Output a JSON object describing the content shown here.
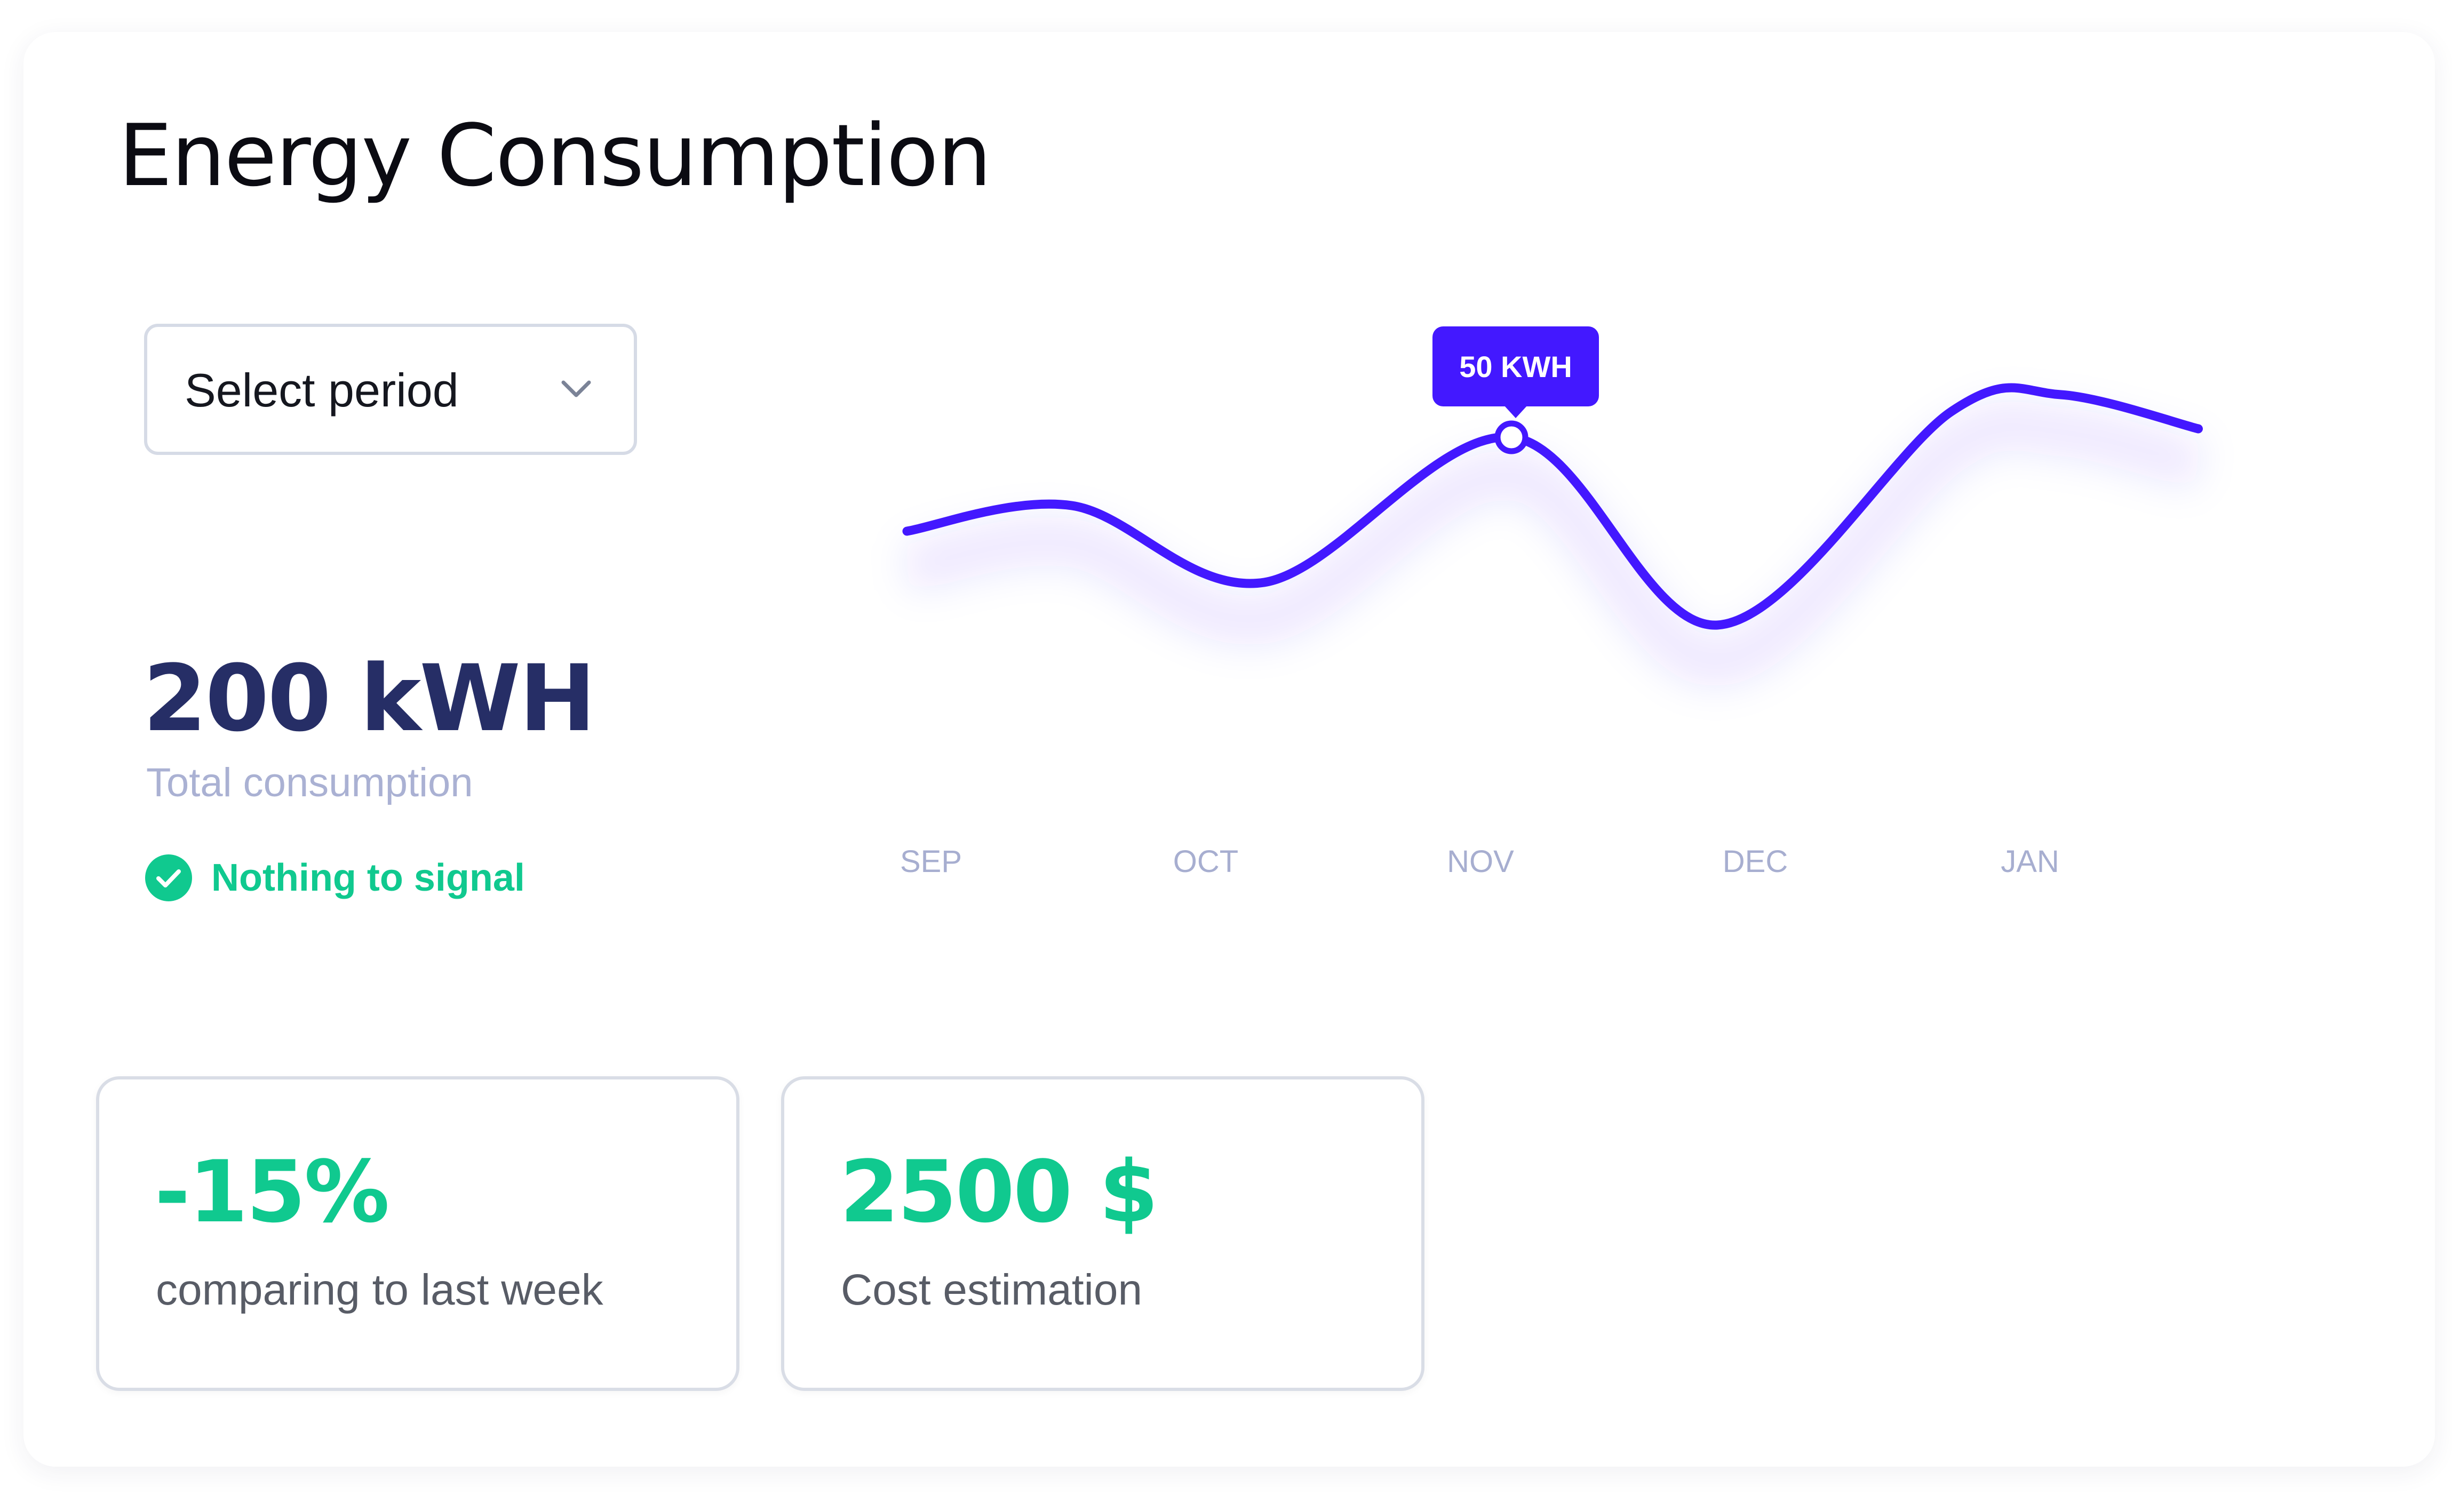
{
  "title": "Energy Consumption",
  "period_select": {
    "label": "Select period",
    "icon": "chevron-down-icon"
  },
  "summary": {
    "total_value": "200 kWH",
    "total_label": "Total consumption",
    "status_text": "Nothing to signal",
    "status_icon": "check-circle-icon"
  },
  "colors": {
    "accent": "#4318ff",
    "success": "#10c98f",
    "primary_text": "#262e66",
    "muted_text": "#aab1d3"
  },
  "chart_data": {
    "type": "line",
    "categories": [
      "SEP",
      "OCT",
      "NOV",
      "DEC",
      "JAN"
    ],
    "x": [
      0.0,
      0.6,
      1.3,
      2.2,
      2.95,
      3.8,
      4.2,
      4.7
    ],
    "y": [
      28,
      34,
      16,
      50,
      6,
      56,
      60,
      52
    ],
    "ylim": [
      0,
      70
    ],
    "highlight": {
      "x": 2.2,
      "label": "50 KWH"
    },
    "grid": false,
    "legend": "none"
  },
  "stats": [
    {
      "value": "-15%",
      "label": "comparing to last week"
    },
    {
      "value": "2500 $",
      "label": "Cost estimation"
    }
  ]
}
